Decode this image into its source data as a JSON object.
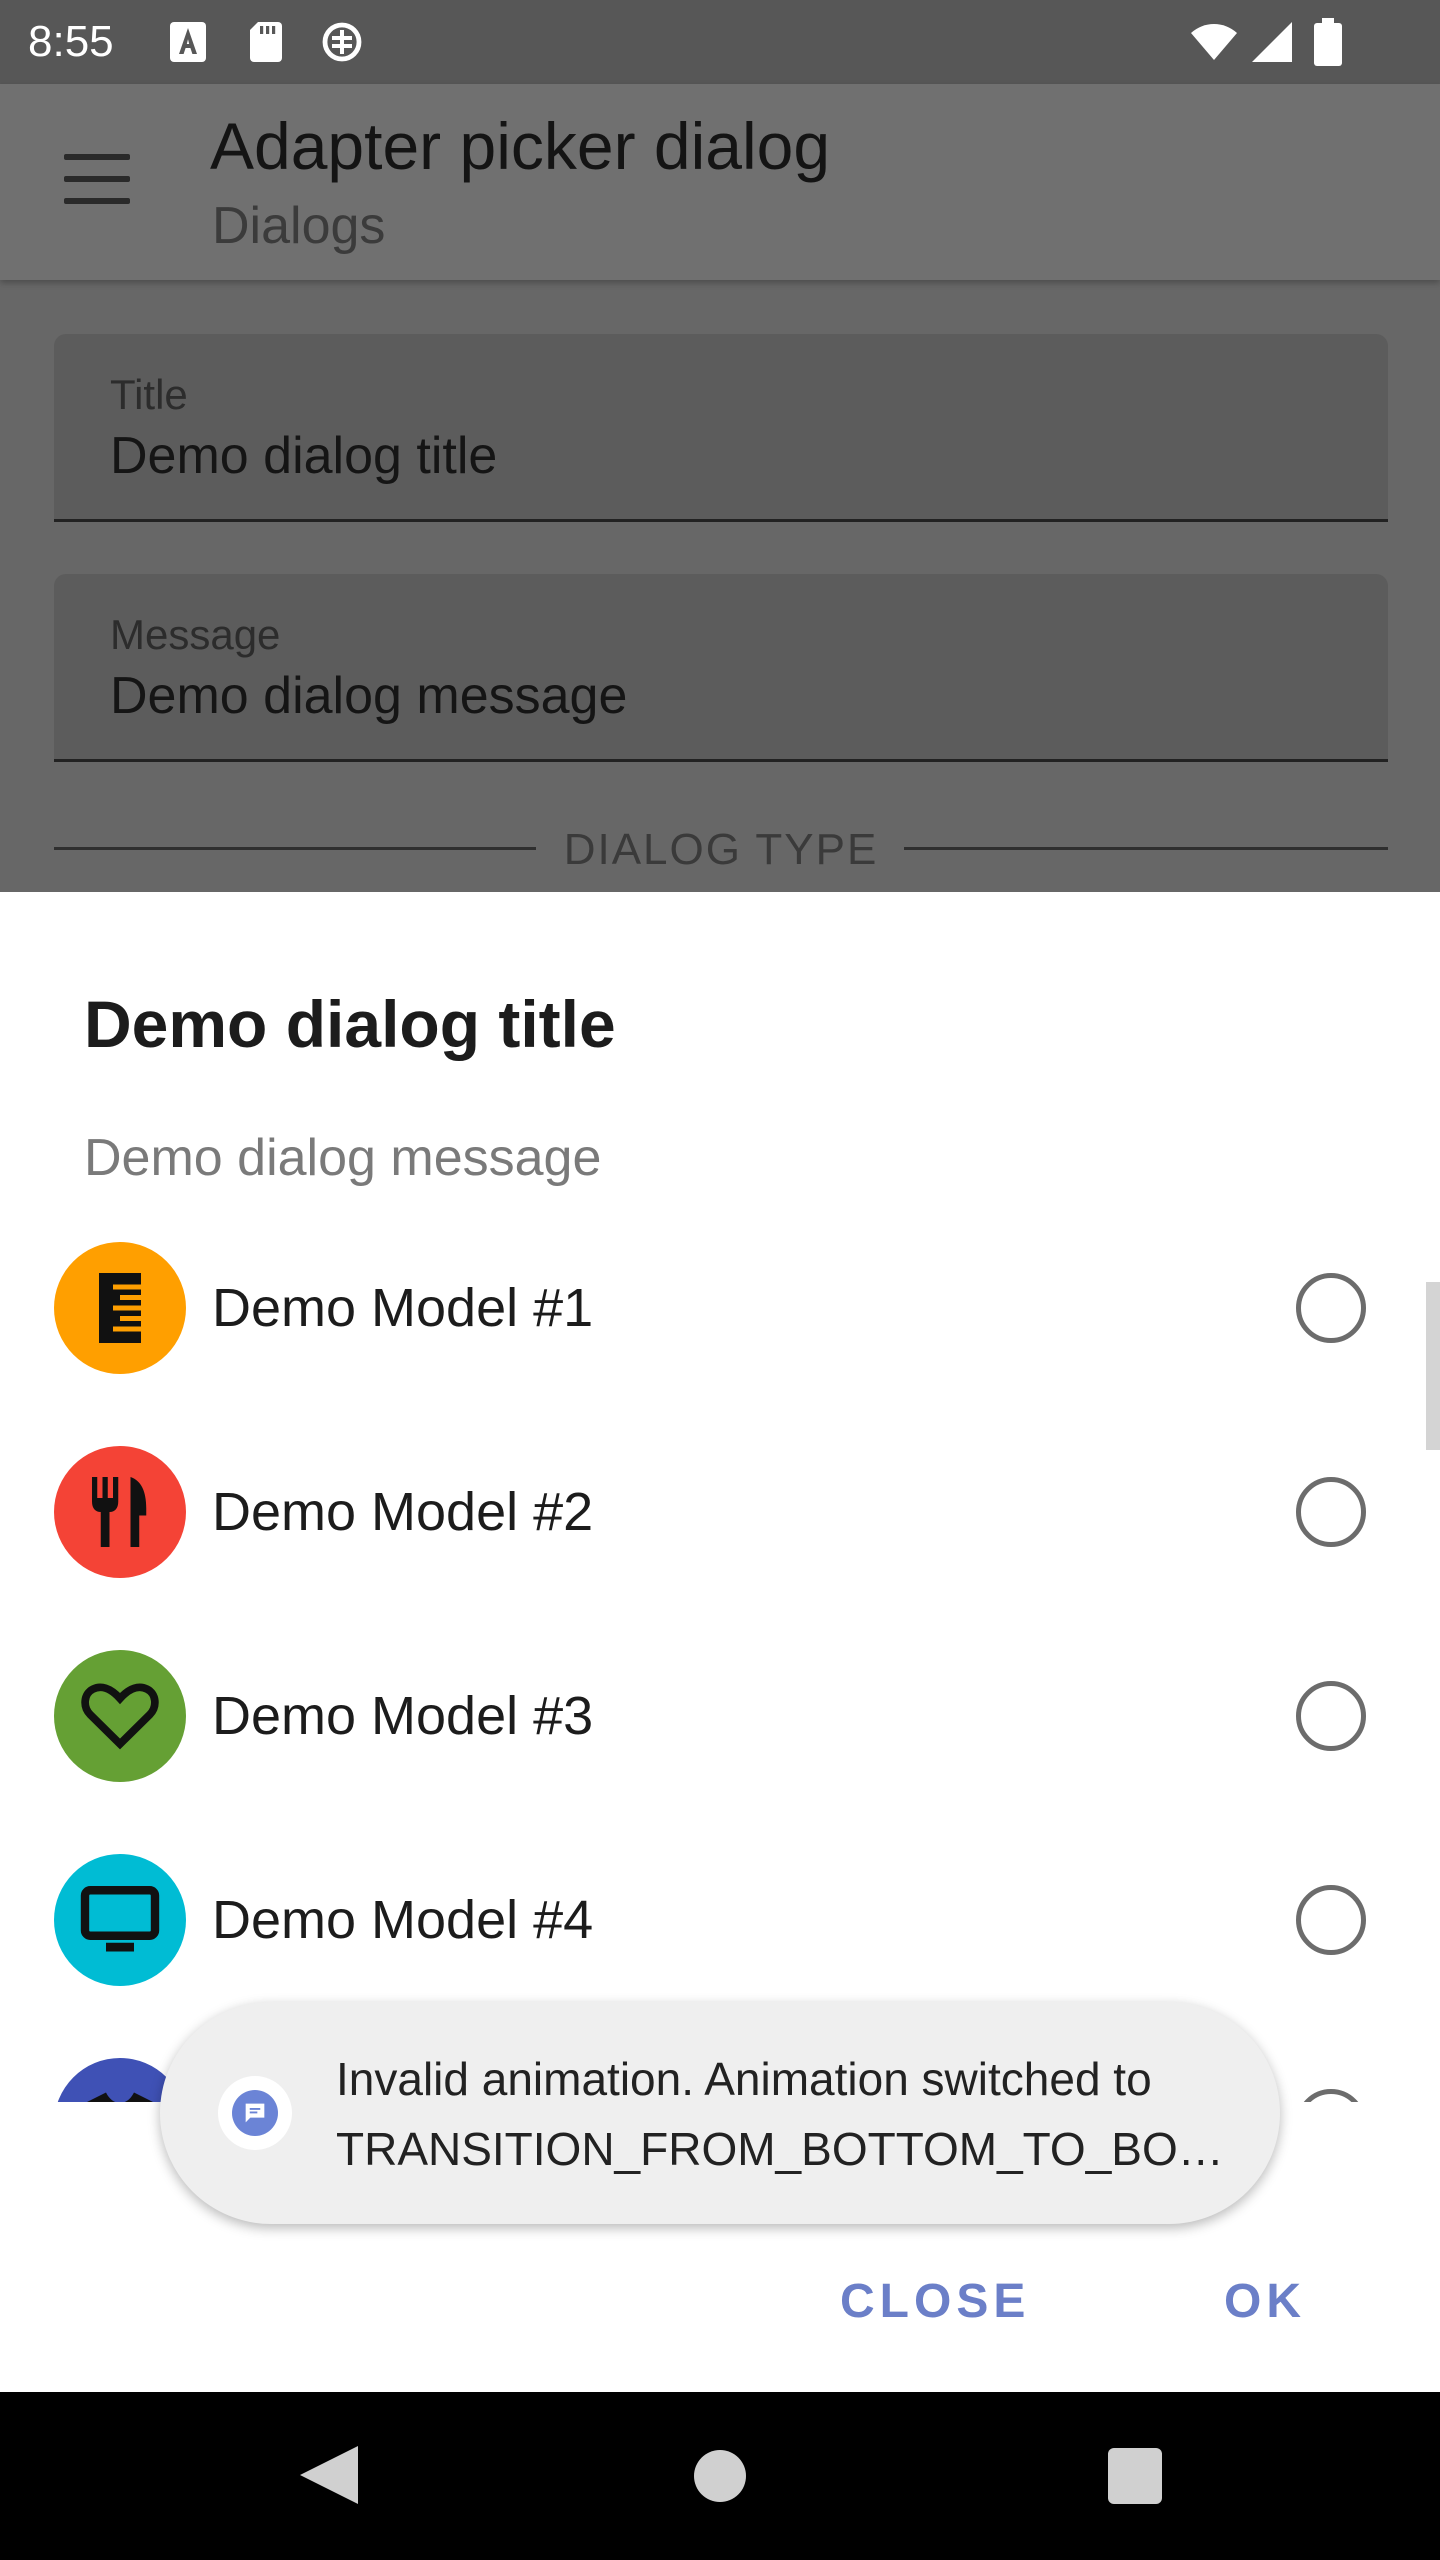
{
  "status_bar": {
    "time": "8:55",
    "left_icons": [
      "font-a-icon",
      "sd-card-icon",
      "signal-strength-icon"
    ],
    "right_icons": [
      "wifi-icon",
      "cell-signal-icon",
      "battery-icon"
    ]
  },
  "toolbar": {
    "title": "Adapter picker dialog",
    "subtitle": "Dialogs",
    "menu_icon": "hamburger-menu-icon"
  },
  "form": {
    "title_field": {
      "label": "Title",
      "value": "Demo dialog title"
    },
    "message_field": {
      "label": "Message",
      "value": "Demo dialog message"
    },
    "section_label": "DIALOG TYPE"
  },
  "dialog": {
    "title": "Demo dialog title",
    "message": "Demo dialog message",
    "items": [
      {
        "label": "Demo Model #1",
        "icon": "ruler-icon",
        "color": "#FF9F00",
        "selected": false
      },
      {
        "label": "Demo Model #2",
        "icon": "fork-knife-icon",
        "color": "#F44336",
        "selected": false
      },
      {
        "label": "Demo Model #3",
        "icon": "heart-icon",
        "color": "#65A034",
        "selected": false
      },
      {
        "label": "Demo Model #4",
        "icon": "monitor-icon",
        "color": "#00BCD4",
        "selected": false
      },
      {
        "label": "",
        "icon": "tshirt-icon",
        "color": "#3F51B5",
        "selected": false
      }
    ],
    "buttons": {
      "close": "CLOSE",
      "ok": "OK"
    }
  },
  "toast": {
    "line1": "Invalid animation. Animation switched to",
    "line2": "TRANSITION_FROM_BOTTOM_TO_BOT…",
    "icon": "message-icon"
  },
  "nav_bar": {
    "back_icon": "back-triangle-icon",
    "home_icon": "home-circle-icon",
    "recents_icon": "recents-square-icon"
  },
  "colors": {
    "accent": "#6B7FC8",
    "scrim": "#676767"
  }
}
